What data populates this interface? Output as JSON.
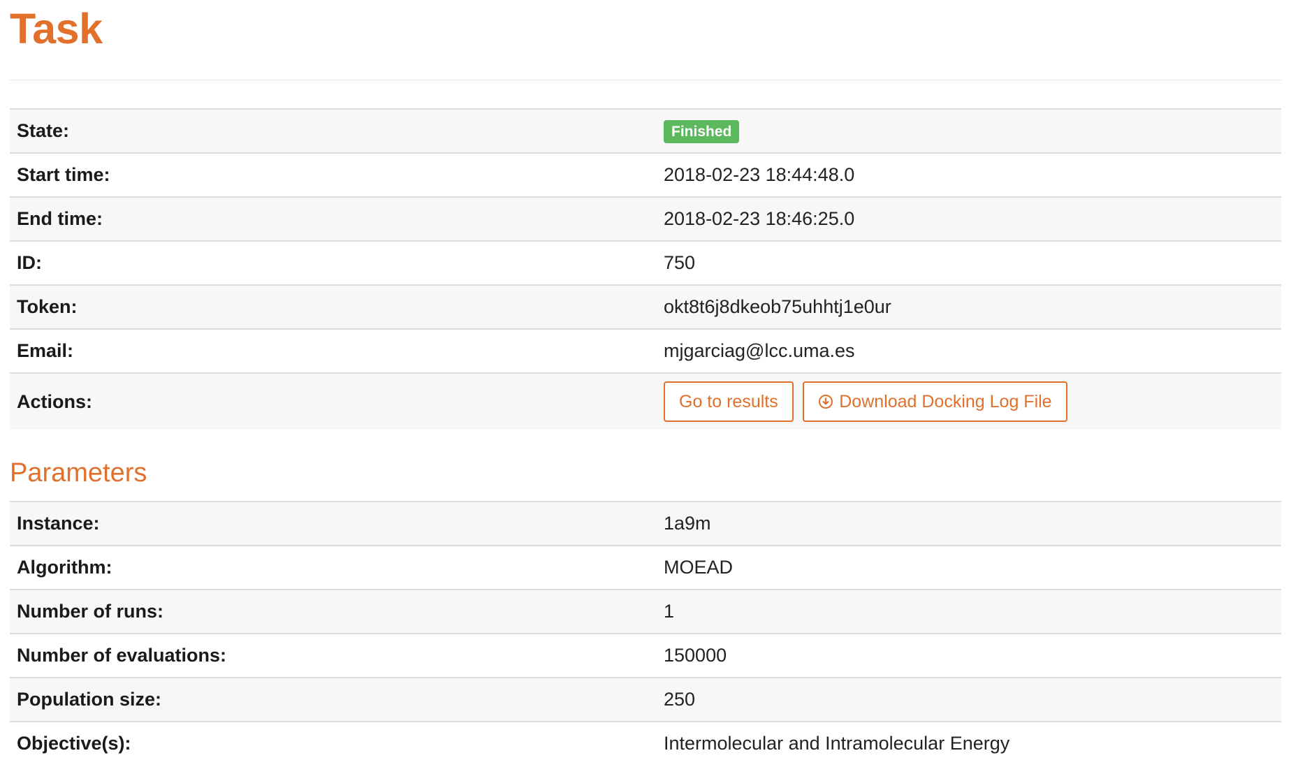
{
  "page": {
    "title": "Task"
  },
  "task": {
    "rows": [
      {
        "label": "State:",
        "value": "Finished"
      },
      {
        "label": "Start time:",
        "value": "2018-02-23 18:44:48.0"
      },
      {
        "label": "End time:",
        "value": "2018-02-23 18:46:25.0"
      },
      {
        "label": "ID:",
        "value": "750"
      },
      {
        "label": "Token:",
        "value": "okt8t6j8dkeob75uhhtj1e0ur"
      },
      {
        "label": "Email:",
        "value": "mjgarciag@lcc.uma.es"
      },
      {
        "label": "Actions:",
        "value": ""
      }
    ],
    "state_badge_color": "#5cb85c",
    "actions": {
      "results_label": "Go to results",
      "download_label": "Download Docking Log File",
      "download_icon": "download-circle-icon"
    }
  },
  "parameters": {
    "title": "Parameters",
    "rows": [
      {
        "label": "Instance:",
        "value": "1a9m"
      },
      {
        "label": "Algorithm:",
        "value": "MOEAD"
      },
      {
        "label": "Number of runs:",
        "value": "1"
      },
      {
        "label": "Number of evaluations:",
        "value": "150000"
      },
      {
        "label": "Population size:",
        "value": "250"
      },
      {
        "label": "Objective(s):",
        "value": "Intermolecular and Intramolecular Energy"
      }
    ]
  },
  "theme": {
    "accent": "#e0702c",
    "success": "#5cb85c"
  }
}
